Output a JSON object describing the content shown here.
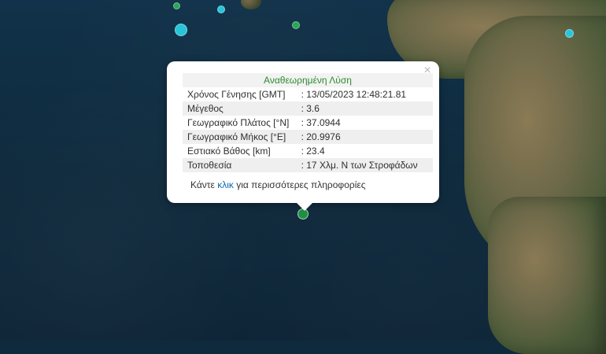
{
  "map": {
    "colors": {
      "sea": "#0f2a3d",
      "land": "#6f6a4a",
      "marker_cyan": "#29c4d8",
      "marker_green": "#2aa657"
    }
  },
  "popup": {
    "title": "Αναθεωρημένη Λύση",
    "rows": [
      {
        "label": "Χρόνος Γένησης [GMT]",
        "value": ": 13/05/2023 12:48:21.81"
      },
      {
        "label": "Μέγεθος",
        "value": ": 3.6"
      },
      {
        "label": "Γεωγραφικό Πλάτος [°N]",
        "value": ": 37.0944"
      },
      {
        "label": "Γεωγραφικό Μήκος [°E]",
        "value": ": 20.9976"
      },
      {
        "label": "Εστιακό Βάθος [km]",
        "value": ": 23.4"
      },
      {
        "label": "Τοποθεσία",
        "value": ": 17 Χλμ. Ν των Στροφάδων"
      }
    ],
    "more_prefix": "Κάντε ",
    "more_link": "κλικ",
    "more_suffix": " για περισσότερες πληροφορίες",
    "close_icon": "×"
  }
}
